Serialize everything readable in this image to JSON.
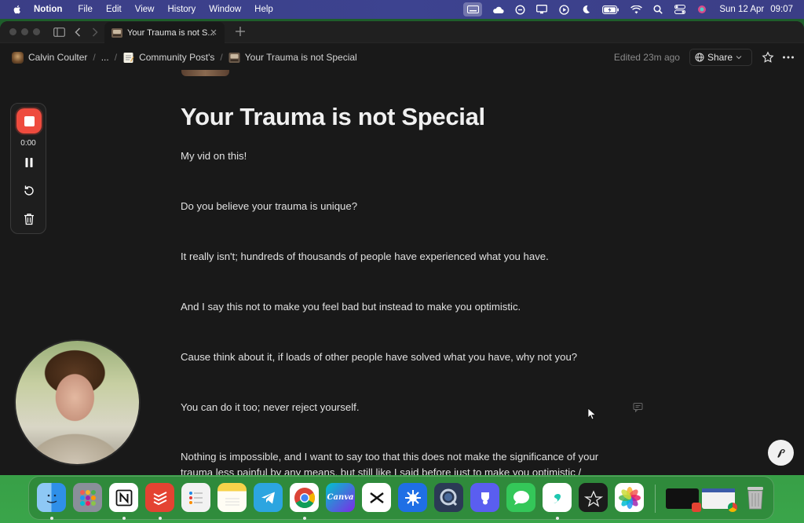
{
  "menubar": {
    "app_name": "Notion",
    "menus": [
      "File",
      "Edit",
      "View",
      "History",
      "Window",
      "Help"
    ],
    "date": "Sun 12 Apr",
    "time": "09:07"
  },
  "tab": {
    "title": "Your Trauma is not S..."
  },
  "breadcrumb": {
    "items": [
      "Calvin Coulter",
      "...",
      "Community Post's",
      "Your Trauma is not Special"
    ]
  },
  "topbar": {
    "edited": "Edited 23m ago",
    "share_label": "Share"
  },
  "page": {
    "title": "Your Trauma is not Special",
    "paragraphs": [
      "My vid on this!",
      "Do you believe your trauma is unique?",
      "It really isn't; hundreds of thousands of people have experienced what you have.",
      "And I say this not to make you feel bad but instead to make you optimistic.",
      "Cause think about it, if loads of other people have solved what you have, why not you?",
      "You can do it too; never reject yourself.",
      "Nothing is impossible, and I want to say too that this does not make the significance of your trauma less painful by any means, but still like I said before just to make you optimistic / positive."
    ]
  },
  "recorder": {
    "timer": "0:00"
  },
  "dock": {
    "apps": [
      {
        "name": "finder",
        "color": "#2f8fe8"
      },
      {
        "name": "launchpad",
        "color": "#8a8f9a"
      },
      {
        "name": "notion",
        "color": "#ffffff"
      },
      {
        "name": "todoist",
        "color": "#e44332"
      },
      {
        "name": "reminders",
        "color": "#f2f2f2"
      },
      {
        "name": "notes",
        "color": "#f7d24a"
      },
      {
        "name": "telegram",
        "color": "#2ca5e0"
      },
      {
        "name": "chrome",
        "color": "#ffffff"
      },
      {
        "name": "canva",
        "label": "Canva",
        "color": "#7d2ae8"
      },
      {
        "name": "capcut",
        "color": "#111111"
      },
      {
        "name": "app-store-like",
        "color": "#1f6fe5"
      },
      {
        "name": "quicktime",
        "color": "#2b3a55"
      },
      {
        "name": "bitwarden-like",
        "color": "#5a5ef0"
      },
      {
        "name": "messages",
        "color": "#34c759"
      },
      {
        "name": "surfshark",
        "color": "#1ec7b0"
      },
      {
        "name": "perplexity-like",
        "color": "#1b1b1b"
      },
      {
        "name": "photos",
        "color": "#ffffff"
      }
    ]
  }
}
